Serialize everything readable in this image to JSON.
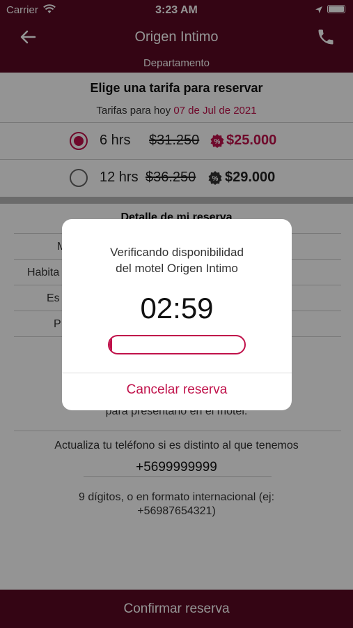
{
  "status_bar": {
    "carrier": "Carrier",
    "time": "3:23 AM"
  },
  "nav": {
    "title": "Origen Intimo",
    "subtitle": "Departamento"
  },
  "rates": {
    "heading": "Elige una tarifa para reservar",
    "date_prefix": "Tarifas para hoy",
    "date": "07 de Jul de 2021",
    "options": [
      {
        "hours": "6 hrs",
        "old_price": "$31.250",
        "new_price": "$25.000",
        "selected": true,
        "color": "#c0114a"
      },
      {
        "hours": "12 hrs",
        "old_price": "$36.250",
        "new_price": "$29.000",
        "selected": false,
        "color": "#333333"
      }
    ]
  },
  "detail": {
    "heading": "Detalle de mi reserva",
    "labels": [
      "M",
      "Habita",
      "Es",
      "P"
    ]
  },
  "info": {
    "present_text": "para presentarlo en el motel.",
    "update_phone": "Actualiza tu teléfono si es distinto al que tenemos",
    "phone": "+5699999999",
    "hint_line1": "9 dígitos, o en formato internacional (ej:",
    "hint_line2": "+56987654321)"
  },
  "confirm_label": "Confirmar reserva",
  "modal": {
    "message_line1": "Verificando disponibilidad",
    "message_line2": "del motel Origen Intimo",
    "timer": "02:59",
    "progress_fraction": 0.01,
    "cancel_label": "Cancelar reserva"
  },
  "icons": {
    "wifi": "wifi-icon",
    "location": "location-arrow-icon",
    "battery": "battery-icon",
    "back": "arrow-left-icon",
    "phone": "phone-icon",
    "discount": "discount-badge-icon"
  },
  "colors": {
    "brand": "#5a0a24",
    "accent": "#c0114a"
  }
}
